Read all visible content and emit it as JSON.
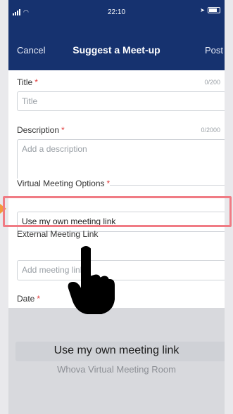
{
  "statusbar": {
    "time": "22:10"
  },
  "navbar": {
    "cancel": "Cancel",
    "title": "Suggest a Meet-up",
    "post": "Post"
  },
  "form": {
    "title": {
      "label": "Title",
      "required_mark": "*",
      "counter": "0/200",
      "placeholder": "Title"
    },
    "description": {
      "label": "Description",
      "required_mark": "*",
      "counter": "0/2000",
      "placeholder": "Add a description"
    },
    "virtual_options": {
      "label": "Virtual Meeting Options",
      "required_mark": "*",
      "value": "Use my own meeting link"
    },
    "external_link": {
      "label": "External Meeting Link",
      "placeholder": "Add meeting link"
    },
    "date": {
      "label": "Date",
      "required_mark": "*"
    }
  },
  "picker": {
    "options": [
      "Use my own meeting link",
      "Whova Virtual Meeting Room"
    ],
    "selected_index": 0
  },
  "colors": {
    "nav_bg": "#16326f",
    "highlight": "#f07b84",
    "required": "#e03b3b"
  }
}
